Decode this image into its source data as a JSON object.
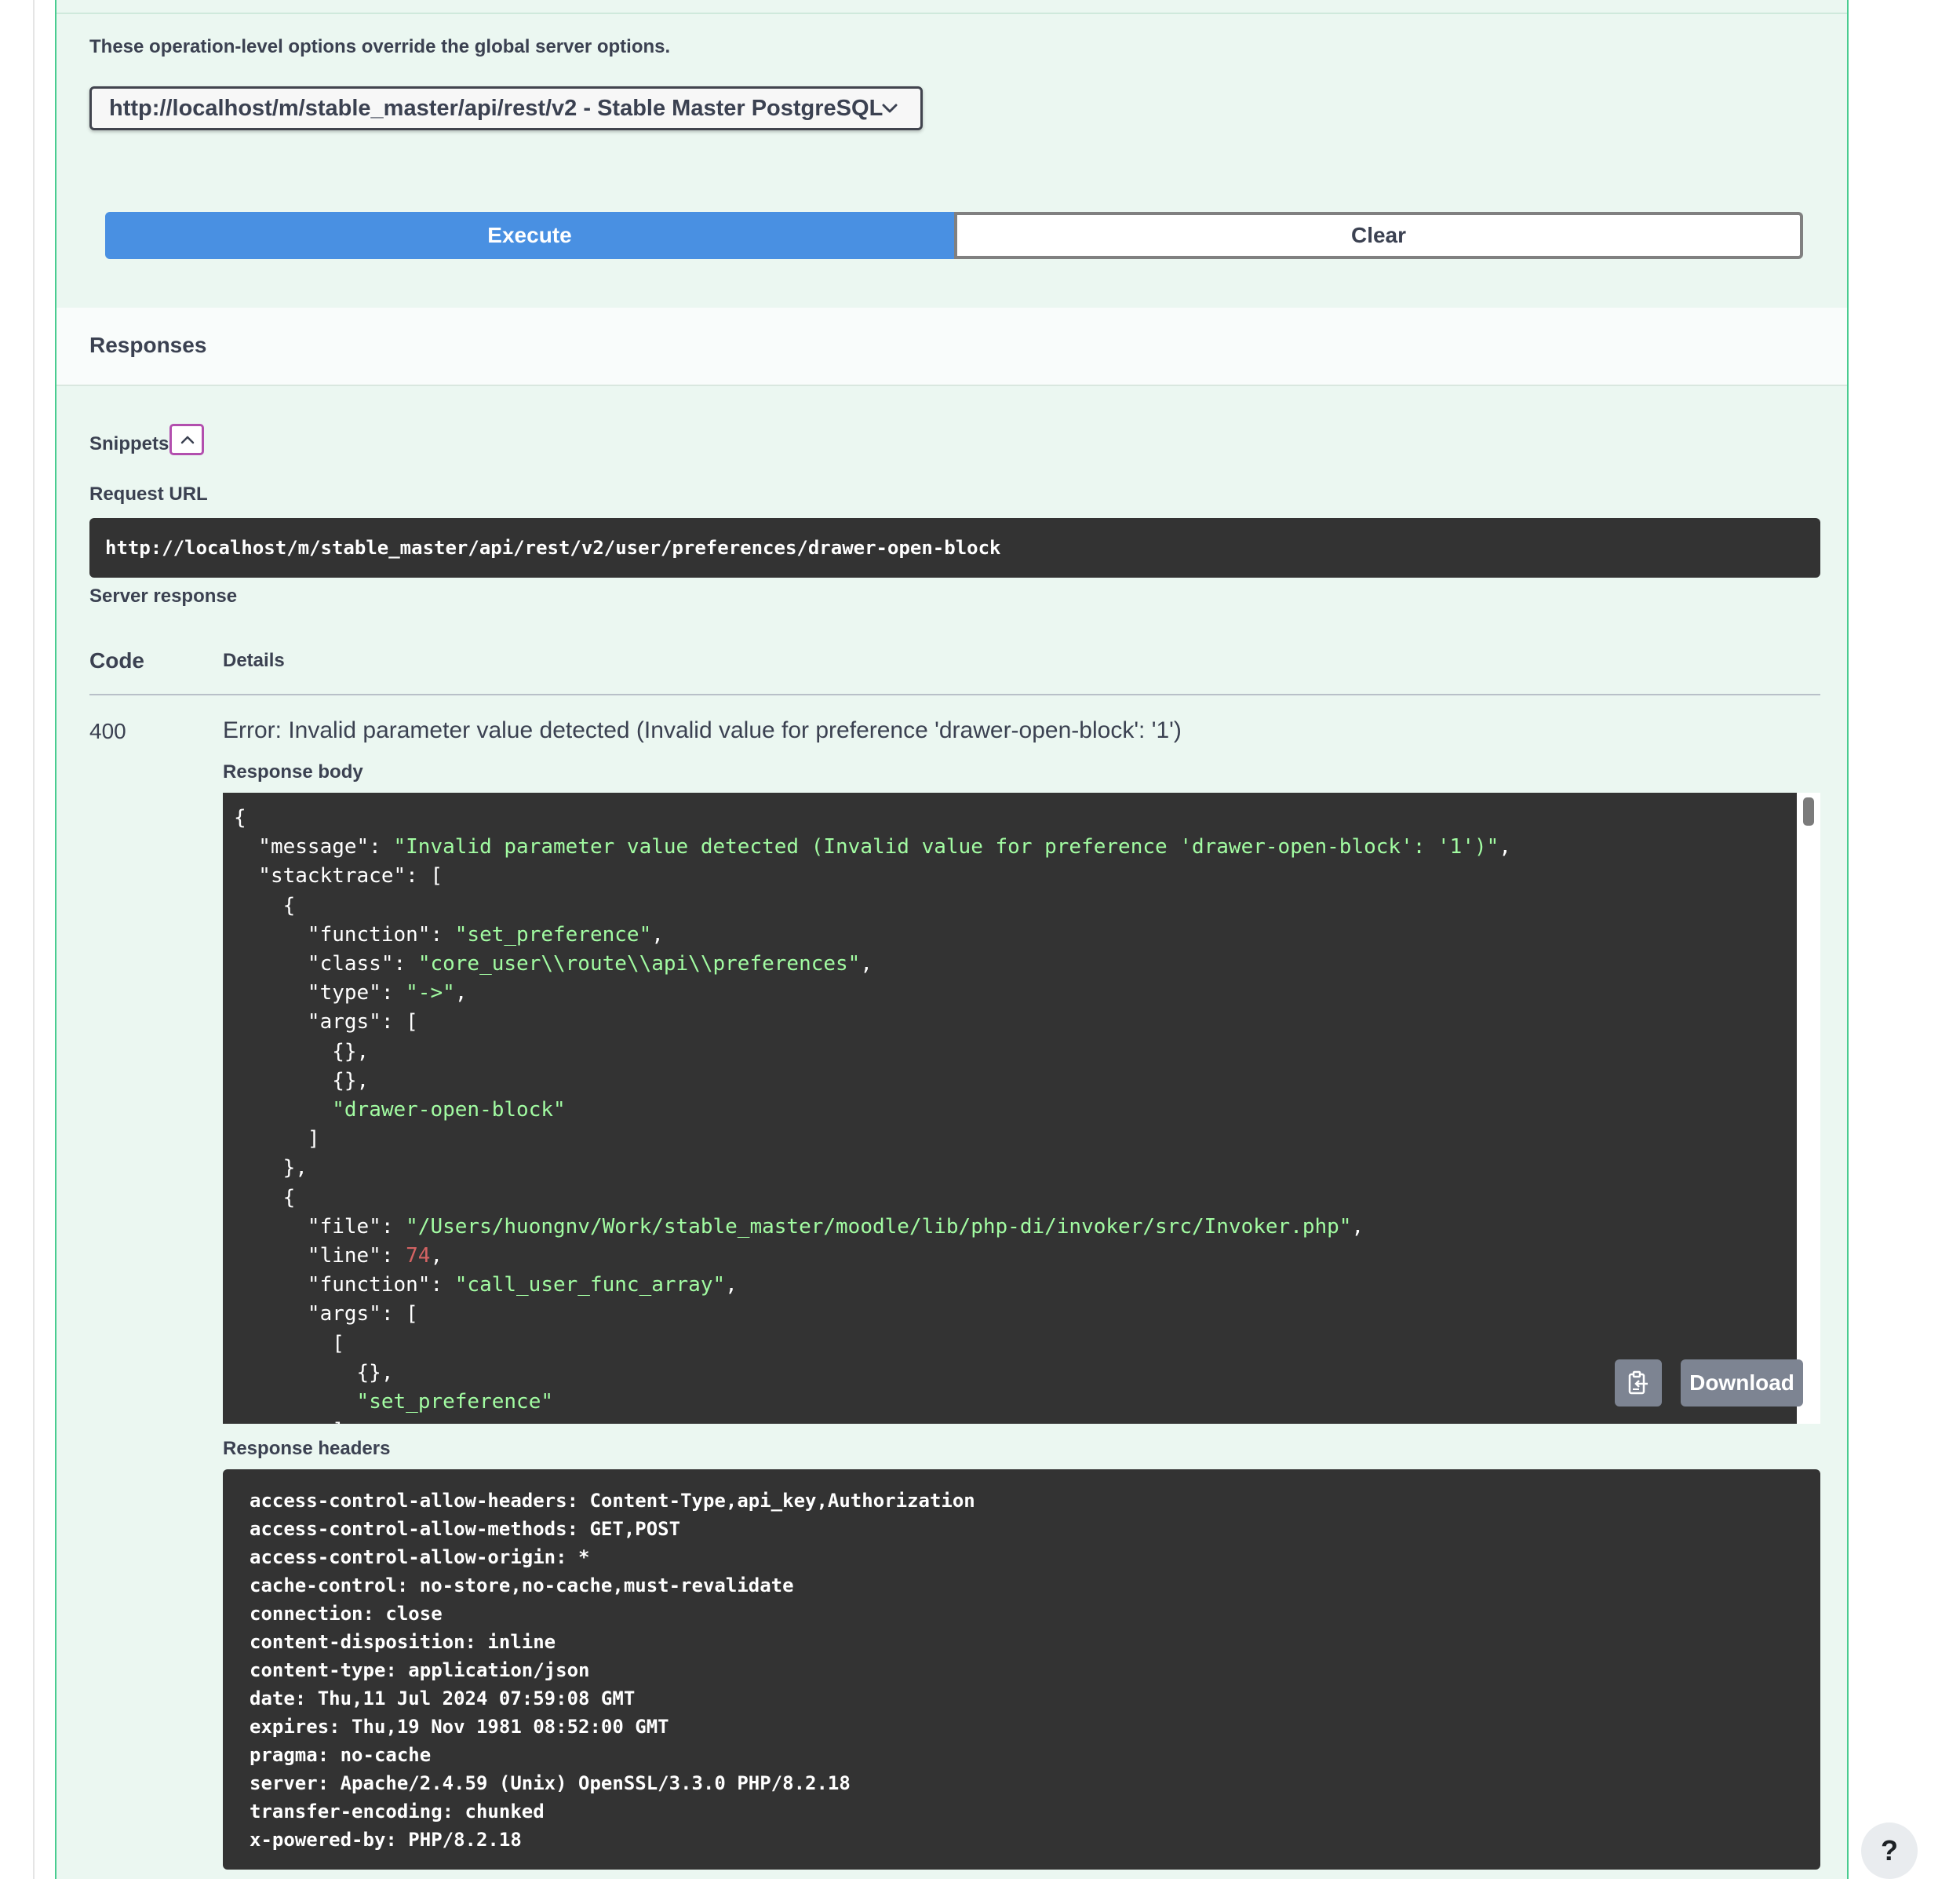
{
  "servers": {
    "note": "These operation-level options override the global server options.",
    "selected": "http://localhost/m/stable_master/api/rest/v2 - Stable Master PostgreSQL"
  },
  "actions": {
    "execute": "Execute",
    "clear": "Clear"
  },
  "responses": {
    "title": "Responses",
    "snippets_label": "Snippets",
    "request_url_label": "Request URL",
    "request_url": "http://localhost/m/stable_master/api/rest/v2/user/preferences/drawer-open-block",
    "server_response_label": "Server response",
    "col_code": "Code",
    "col_details": "Details",
    "status_code": "400",
    "status_message": "Error: Invalid parameter value detected (Invalid value for preference 'drawer-open-block': '1')",
    "response_body_label": "Response body",
    "response_body_lines": [
      [
        [
          "p",
          "{"
        ]
      ],
      [
        [
          "p",
          "  \"message\": "
        ],
        [
          "s",
          "\"Invalid parameter value detected (Invalid value for preference 'drawer-open-block': '1')\""
        ],
        [
          "p",
          ","
        ]
      ],
      [
        [
          "p",
          "  \"stacktrace\": ["
        ]
      ],
      [
        [
          "p",
          "    {"
        ]
      ],
      [
        [
          "p",
          "      \"function\": "
        ],
        [
          "s",
          "\"set_preference\""
        ],
        [
          "p",
          ","
        ]
      ],
      [
        [
          "p",
          "      \"class\": "
        ],
        [
          "s",
          "\"core_user\\\\route\\\\api\\\\preferences\""
        ],
        [
          "p",
          ","
        ]
      ],
      [
        [
          "p",
          "      \"type\": "
        ],
        [
          "s",
          "\"->\""
        ],
        [
          "p",
          ","
        ]
      ],
      [
        [
          "p",
          "      \"args\": ["
        ]
      ],
      [
        [
          "p",
          "        {},"
        ]
      ],
      [
        [
          "p",
          "        {},"
        ]
      ],
      [
        [
          "p",
          "        "
        ],
        [
          "s",
          "\"drawer-open-block\""
        ]
      ],
      [
        [
          "p",
          "      ]"
        ]
      ],
      [
        [
          "p",
          "    },"
        ]
      ],
      [
        [
          "p",
          "    {"
        ]
      ],
      [
        [
          "p",
          "      \"file\": "
        ],
        [
          "s",
          "\"/Users/huongnv/Work/stable_master/moodle/lib/php-di/invoker/src/Invoker.php\""
        ],
        [
          "p",
          ","
        ]
      ],
      [
        [
          "p",
          "      \"line\": "
        ],
        [
          "n",
          "74"
        ],
        [
          "p",
          ","
        ]
      ],
      [
        [
          "p",
          "      \"function\": "
        ],
        [
          "s",
          "\"call_user_func_array\""
        ],
        [
          "p",
          ","
        ]
      ],
      [
        [
          "p",
          "      \"args\": ["
        ]
      ],
      [
        [
          "p",
          "        ["
        ]
      ],
      [
        [
          "p",
          "          {},"
        ]
      ],
      [
        [
          "p",
          "          "
        ],
        [
          "s",
          "\"set_preference\""
        ]
      ],
      [
        [
          "p",
          "        ],"
        ]
      ]
    ],
    "download_label": "Download",
    "response_headers_label": "Response headers",
    "response_headers": [
      "access-control-allow-headers: Content-Type,api_key,Authorization",
      "access-control-allow-methods: GET,POST",
      "access-control-allow-origin: *",
      "cache-control: no-store,no-cache,must-revalidate",
      "connection: close",
      "content-disposition: inline",
      "content-type: application/json",
      "date: Thu,11 Jul 2024 07:59:08 GMT",
      "expires: Thu,19 Nov 1981 08:52:00 GMT",
      "pragma: no-cache",
      "server: Apache/2.4.59 (Unix) OpenSSL/3.3.0 PHP/8.2.18",
      "transfer-encoding: chunked",
      "x-powered-by: PHP/8.2.18"
    ]
  },
  "help": {
    "label": "?"
  },
  "colors": {
    "execute_bg": "#4990e2",
    "opblock_bg": "#ebf7f1",
    "opblock_border": "#49cc90",
    "code_bg": "#333333",
    "json_string": "#a2fca2",
    "json_number": "#d36363"
  }
}
